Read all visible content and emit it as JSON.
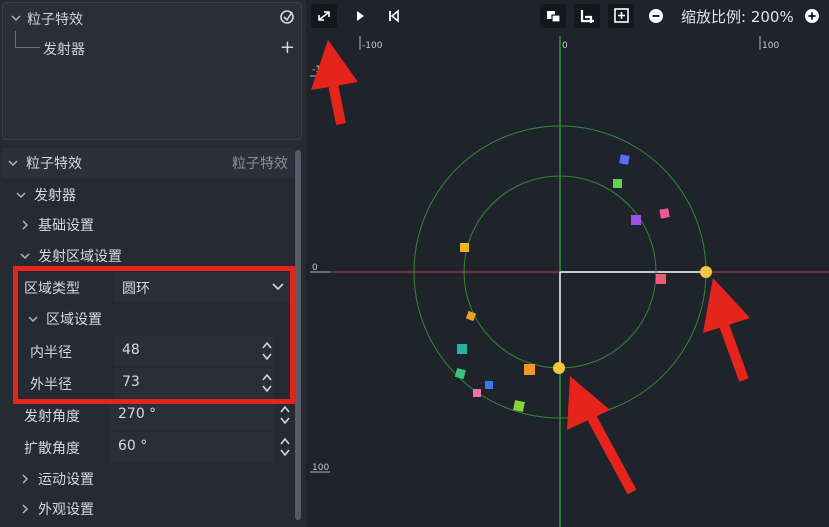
{
  "hierarchy": {
    "root_label": "粒子特效",
    "child_label": "发射器"
  },
  "properties": {
    "section_title": "粒子特效",
    "section_right": "粒子特效",
    "emitter_label": "发射器",
    "basic_settings": "基础设置",
    "emit_area_settings": "发射区域设置",
    "area_type_label": "区域类型",
    "area_type_value": "圆环",
    "area_settings": "区域设置",
    "inner_radius_label": "内半径",
    "inner_radius_value": "48",
    "outer_radius_label": "外半径",
    "outer_radius_value": "73",
    "emit_angle_label": "发射角度",
    "emit_angle_value": "270 °",
    "spread_angle_label": "扩散角度",
    "spread_angle_value": "60 °",
    "motion_settings": "运动设置",
    "appearance_settings": "外观设置"
  },
  "toolbar": {
    "zoom_label": "缩放比例:",
    "zoom_value": "200%"
  },
  "ruler": {
    "x_ticks": [
      "-100",
      "0",
      "100"
    ],
    "y_ticks": [
      "-1",
      "0",
      "100"
    ]
  },
  "icons": [
    "fx-icon",
    "plus-icon",
    "fullscreen-icon",
    "play-icon",
    "step-back-icon",
    "layers-icon",
    "crop-icon",
    "fit-icon",
    "zoom-out-icon",
    "zoom-in-icon"
  ],
  "colors": {
    "annotation_red": "#e5241c",
    "axis_x": "#d33a3a",
    "axis_y": "#3ec83e",
    "ring": "#2f8a33",
    "handle": "#f0c840"
  }
}
